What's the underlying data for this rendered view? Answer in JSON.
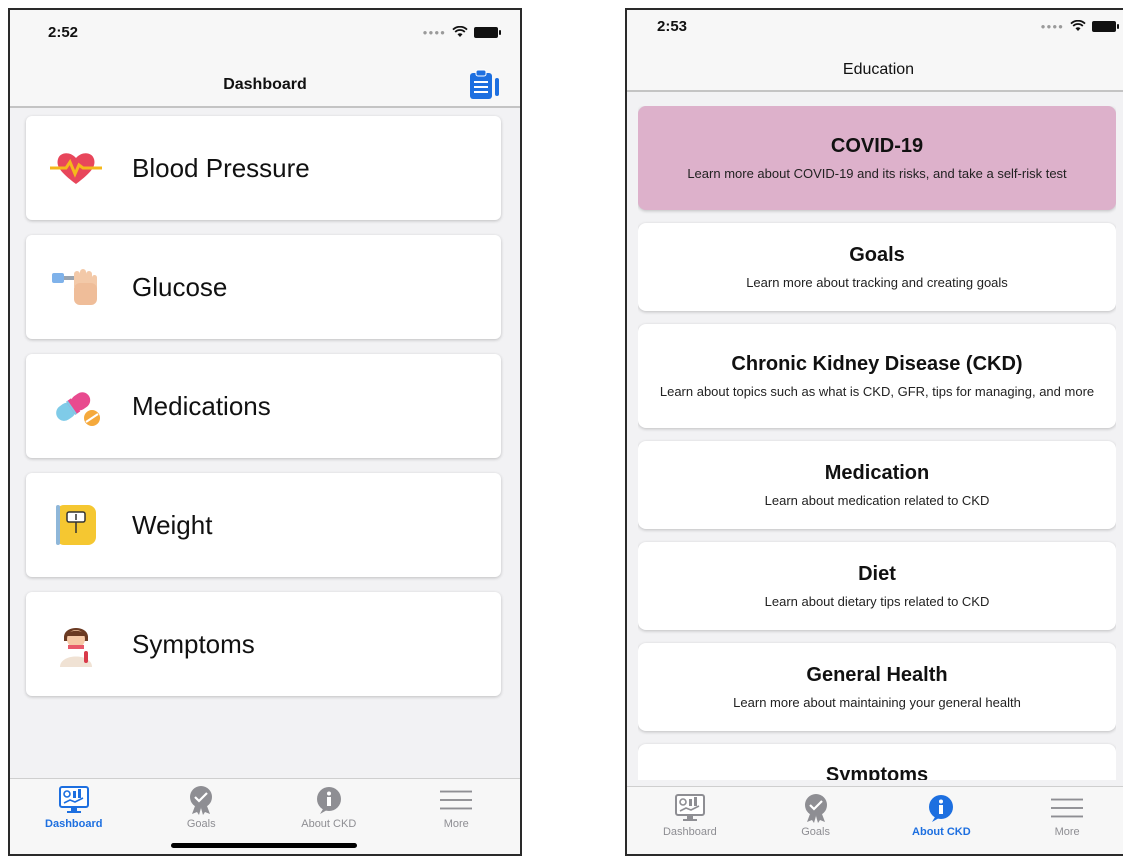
{
  "colors": {
    "accent": "#1d6fe0",
    "highlight_card": "#ddb1cb",
    "inactive_tab": "#8e8e93"
  },
  "dashboard_screen": {
    "status_time": "2:52",
    "nav_title": "Dashboard",
    "nav_action_icon": "clipboard-icon",
    "items": [
      {
        "label": "Blood Pressure",
        "icon": "heart-icon"
      },
      {
        "label": "Glucose",
        "icon": "glucose-meter-icon"
      },
      {
        "label": "Medications",
        "icon": "pills-icon"
      },
      {
        "label": "Weight",
        "icon": "scale-icon"
      },
      {
        "label": "Symptoms",
        "icon": "sick-person-icon"
      }
    ],
    "tabs": [
      {
        "label": "Dashboard",
        "icon": "dashboard-icon",
        "active": true
      },
      {
        "label": "Goals",
        "icon": "goals-badge-icon",
        "active": false
      },
      {
        "label": "About CKD",
        "icon": "info-icon",
        "active": false
      },
      {
        "label": "More",
        "icon": "menu-icon",
        "active": false
      }
    ]
  },
  "education_screen": {
    "status_time": "2:53",
    "nav_title": "Education",
    "cards": [
      {
        "title": "COVID-19",
        "description": "Learn more about COVID-19 and its risks, and take a self-risk test"
      },
      {
        "title": "Goals",
        "description": "Learn more about tracking and creating goals"
      },
      {
        "title": "Chronic Kidney Disease (CKD)",
        "description": "Learn about topics such as what is CKD, GFR, tips for managing, and more"
      },
      {
        "title": "Medication",
        "description": "Learn about medication related to CKD"
      },
      {
        "title": "Diet",
        "description": "Learn about dietary tips related to CKD"
      },
      {
        "title": "General Health",
        "description": "Learn more about maintaining your general health"
      },
      {
        "title": "Symptoms",
        "description": ""
      }
    ],
    "tabs": [
      {
        "label": "Dashboard",
        "icon": "dashboard-icon",
        "active": false
      },
      {
        "label": "Goals",
        "icon": "goals-badge-icon",
        "active": false
      },
      {
        "label": "About CKD",
        "icon": "info-icon",
        "active": true
      },
      {
        "label": "More",
        "icon": "menu-icon",
        "active": false
      }
    ]
  }
}
